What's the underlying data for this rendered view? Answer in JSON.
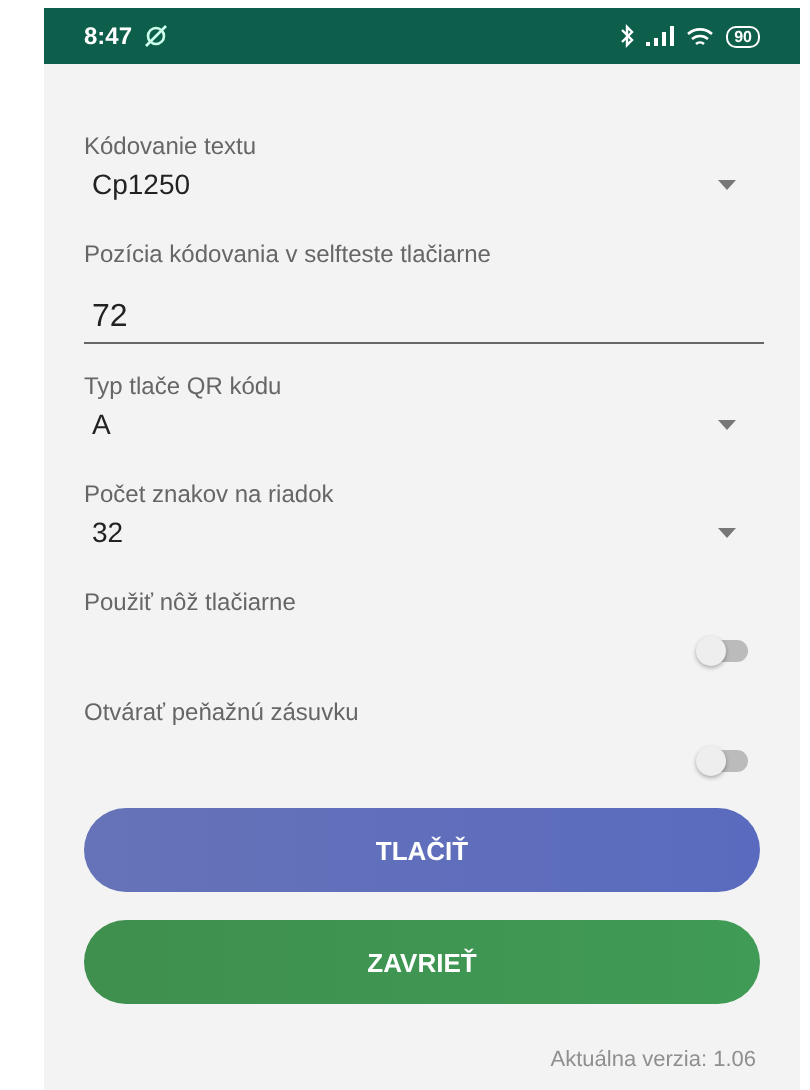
{
  "status_bar": {
    "time": "8:47",
    "battery": "90"
  },
  "fields": [
    {
      "kind": "select",
      "label": "Kódovanie textu",
      "value": "Cp1250"
    },
    {
      "kind": "input",
      "label": "Pozícia kódovania v selfteste tlačiarne",
      "value": "72"
    },
    {
      "kind": "select",
      "label": "Typ tlače QR kódu",
      "value": "A"
    },
    {
      "kind": "select",
      "label": "Počet znakov na riadok",
      "value": "32"
    },
    {
      "kind": "switch",
      "label": "Použiť nôž tlačiarne",
      "on": false
    },
    {
      "kind": "switch",
      "label": "Otvárať peňažnú zásuvku",
      "on": false
    }
  ],
  "buttons": [
    {
      "kind": "print",
      "label": "TLAČIŤ"
    },
    {
      "kind": "close",
      "label": "ZAVRIEŤ"
    }
  ],
  "version": "Aktuálna verzia: 1.06"
}
